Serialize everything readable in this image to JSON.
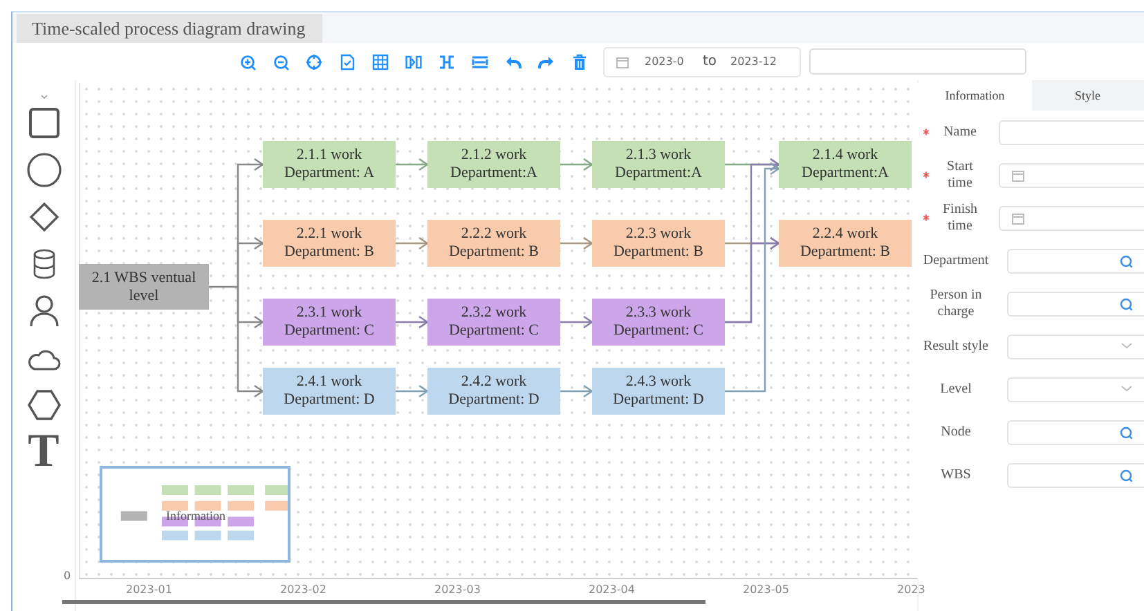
{
  "title_tab": {
    "label": "Time-scaled process diagram drawing",
    "selected": true
  },
  "toolbar": {
    "tools": [
      {
        "kind": "zoom-in"
      },
      {
        "kind": "zoom-out"
      },
      {
        "kind": "fit"
      },
      {
        "kind": "export"
      },
      {
        "kind": "grid"
      },
      {
        "kind": "fit-width"
      },
      {
        "kind": "expand"
      },
      {
        "kind": "spread"
      },
      {
        "kind": "undo"
      },
      {
        "kind": "redo"
      },
      {
        "kind": "delete"
      }
    ],
    "date_range": {
      "start": "2023-0",
      "separator": "to",
      "end": "2023-12"
    }
  },
  "palette": [
    {
      "kind": "rect"
    },
    {
      "kind": "circle"
    },
    {
      "kind": "diamond"
    },
    {
      "kind": "cylinder"
    },
    {
      "kind": "person"
    },
    {
      "kind": "cloud"
    },
    {
      "kind": "hexagon"
    },
    {
      "kind": "text",
      "glyph": "T"
    }
  ],
  "diagram": {
    "root": "2.1 WBS ventual level",
    "rows": [
      {
        "color": "#c5e0b4",
        "nodes": [
          "2.1.1 work\nDepartment: A",
          "2.1.2 work\nDepartment:A",
          "2.1.3 work\nDepartment:A",
          "2.1.4 work\nDepartment:A"
        ]
      },
      {
        "color": "#f8cbad",
        "nodes": [
          "2.2.1 work\nDepartment: B",
          "2.2.2 work\nDepartment: B",
          "2.2.3 work\nDepartment: B",
          "2.2.4 work\nDepartment: B"
        ]
      },
      {
        "color": "#cca6e8",
        "nodes": [
          "2.3.1 work\nDepartment: C",
          "2.3.2 work\nDepartment: C",
          "2.3.3 work\nDepartment: C"
        ]
      },
      {
        "color": "#bdd7ee",
        "nodes": [
          "2.4.1 work\nDepartment: D",
          "2.4.2 work\nDepartment: D",
          "2.4.3 work\nDepartment: D"
        ]
      }
    ]
  },
  "minimap": {
    "label": "Information"
  },
  "axis": {
    "y_label": "0",
    "x_labels": [
      "2023-01",
      "2023-02",
      "2023-03",
      "2023-04",
      "2023-05",
      "2023"
    ]
  },
  "panel": {
    "tabs": [
      {
        "label": "Information",
        "selected": true
      },
      {
        "label": "Style",
        "selected": false
      }
    ],
    "fields": [
      {
        "label": "Name",
        "required": true,
        "kind": "text"
      },
      {
        "label": "Start time",
        "required": true,
        "kind": "date"
      },
      {
        "label": "Finish time",
        "required": true,
        "kind": "date"
      },
      {
        "label": "Department",
        "required": false,
        "kind": "search"
      },
      {
        "label": "Person in charge",
        "required": false,
        "kind": "search"
      },
      {
        "label": "Result style",
        "required": false,
        "kind": "select"
      },
      {
        "label": "Level",
        "required": false,
        "kind": "select"
      },
      {
        "label": "Node",
        "required": false,
        "kind": "search"
      },
      {
        "label": "WBS",
        "required": false,
        "kind": "search"
      }
    ]
  }
}
